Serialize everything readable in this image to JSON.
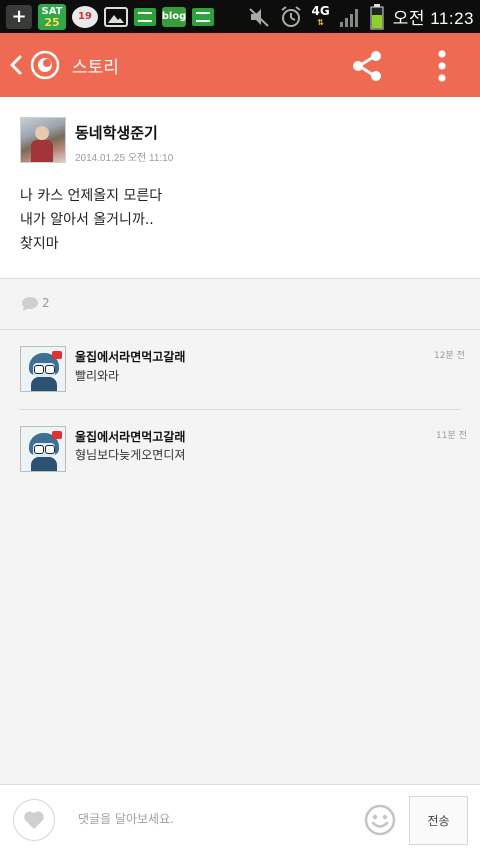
{
  "status_bar": {
    "calendar_day": "SAT",
    "calendar_date": "25",
    "sticker_text": "19",
    "blog_label": "blog",
    "network": "4G",
    "time": "오전 11:23"
  },
  "app_bar": {
    "title": "스토리",
    "accent_color": "#ef6a52"
  },
  "post": {
    "author": "동네학생준기",
    "timestamp": "2014.01.25 오전 11:10",
    "lines": [
      "나 카스 언제올지 모른다",
      "내가 알아서 올거니까..",
      "찾지마"
    ]
  },
  "comment_count": "2",
  "comments": [
    {
      "name": "울집에서라면먹고갈래",
      "text": "빨리와라",
      "time": "12분 전"
    },
    {
      "name": "울집에서라면먹고갈래",
      "text": "형님보다늦게오면디져",
      "time": "11분 전"
    }
  ],
  "input_bar": {
    "placeholder": "댓글을 달아보세요.",
    "send_label": "전송"
  },
  "icons": {
    "back": "chevron-left-icon",
    "logo": "kakaostory-logo-icon",
    "share": "share-icon",
    "more": "more-vertical-icon",
    "comment": "speech-bubble-icon",
    "like": "heart-icon",
    "emoji": "smiley-icon"
  }
}
